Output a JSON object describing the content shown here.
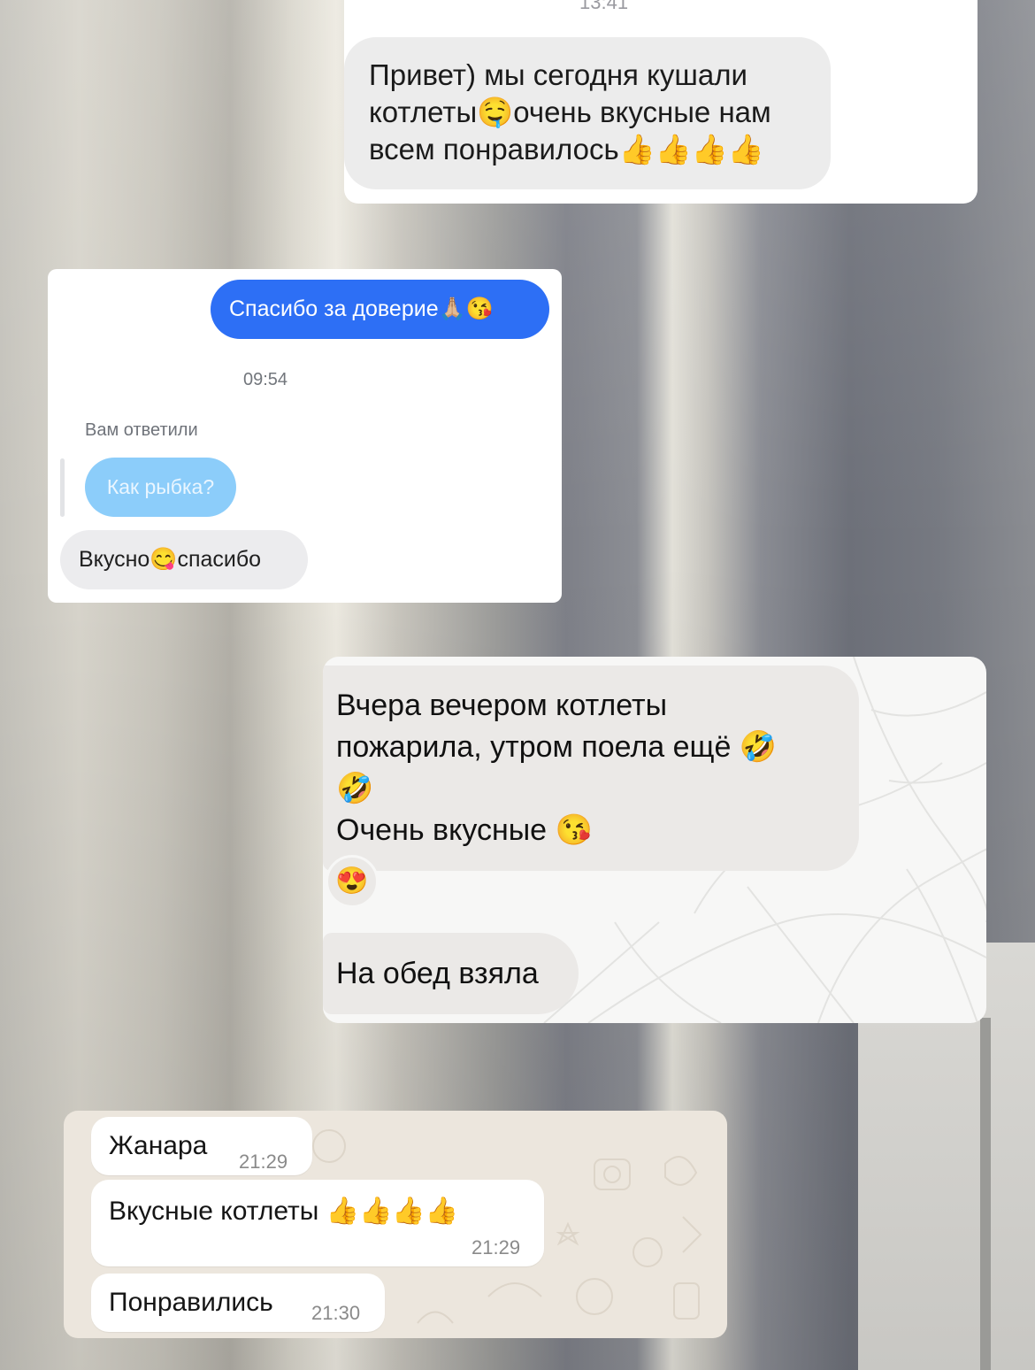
{
  "card1": {
    "timestamp_partial": "13:41",
    "incoming_message": "Привет) мы сегодня кушали котлеты🤤очень вкусные нам всем понравилось👍👍👍👍"
  },
  "card2": {
    "outgoing_message": "Спасибо за доверие🙏🏼😘",
    "time": "09:54",
    "replied_label": "Вам ответили",
    "quoted_message": "Как рыбка?",
    "reply_message": "Вкусно😋спасибо"
  },
  "card3": {
    "message_1_line_1": "Вчера вечером котлеты",
    "message_1_line_2": "пожарила,  утром поела ещё 🤣",
    "message_1_line_3": "🤣",
    "message_1_line_4": "Очень вкусные 😘",
    "reaction": "😍",
    "message_2": "На обед взяла"
  },
  "card4": {
    "messages": [
      {
        "text": "Жанара",
        "time": "21:29"
      },
      {
        "text": "Вкусные котлеты 👍👍👍👍",
        "time": "21:29"
      },
      {
        "text": "Понравились",
        "time": "21:30"
      }
    ],
    "colors": {
      "background": "#ece6dd",
      "bubble": "#ffffff"
    }
  }
}
